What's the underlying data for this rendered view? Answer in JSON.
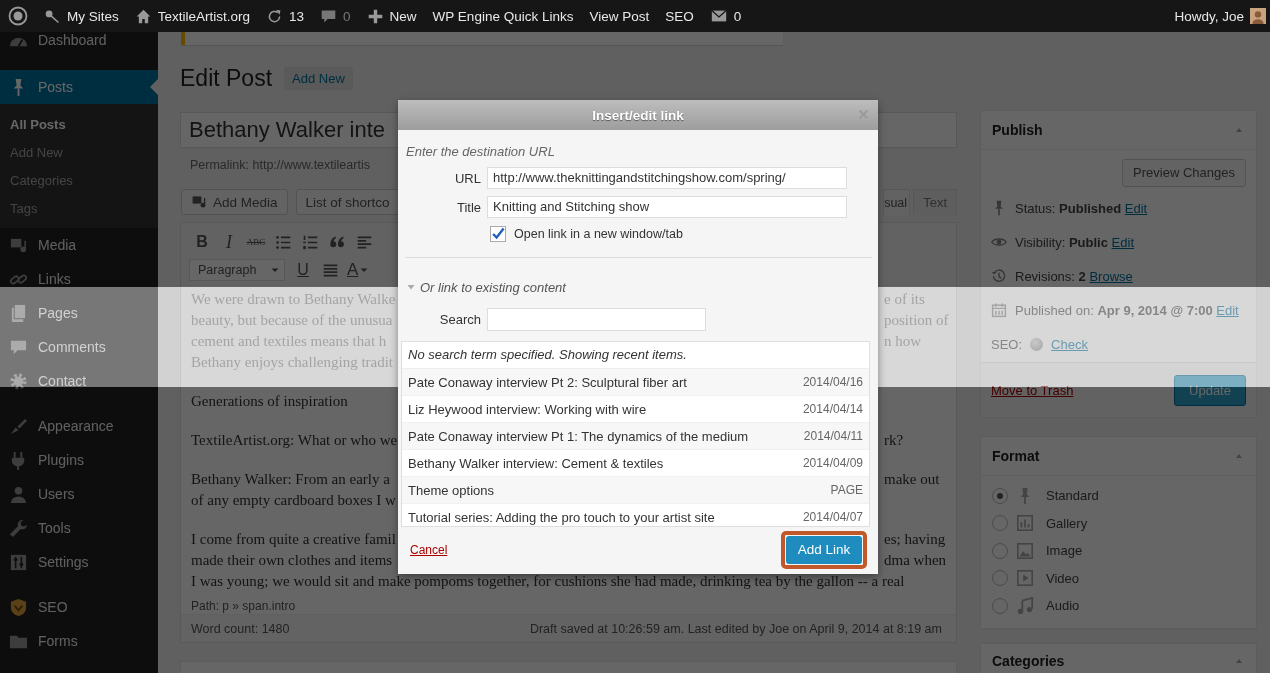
{
  "admin_bar": {
    "items": [
      {
        "kind": "logo"
      },
      {
        "kind": "sites",
        "label": "My Sites"
      },
      {
        "kind": "home",
        "label": "TextileArtist.org"
      },
      {
        "kind": "updates",
        "label": "13"
      },
      {
        "kind": "comments",
        "label": "0"
      },
      {
        "kind": "new",
        "label": "New"
      },
      {
        "kind": "plain",
        "label": "WP Engine Quick Links"
      },
      {
        "kind": "plain",
        "label": "View Post"
      },
      {
        "kind": "plain",
        "label": "SEO"
      },
      {
        "kind": "mail",
        "label": "0"
      }
    ],
    "greeting": "Howdy, Joe"
  },
  "sidebar": {
    "groups": [
      [
        {
          "label": "Dashboard",
          "kind": "dashboard",
          "selected": false
        },
        {
          "label": "Posts",
          "kind": "pin",
          "selected": true,
          "children": [
            {
              "label": "All Posts",
              "selected": true
            },
            {
              "label": "Add New",
              "selected": false
            },
            {
              "label": "Categories",
              "selected": false
            },
            {
              "label": "Tags",
              "selected": false
            }
          ]
        },
        {
          "label": "Media",
          "kind": "media",
          "selected": false
        },
        {
          "label": "Links",
          "kind": "link",
          "selected": false
        },
        {
          "label": "Pages",
          "kind": "pages",
          "selected": false
        },
        {
          "label": "Comments",
          "kind": "comment",
          "selected": false
        },
        {
          "label": "Contact",
          "kind": "gear",
          "selected": false
        }
      ],
      [
        {
          "label": "Appearance",
          "kind": "brush",
          "selected": false
        },
        {
          "label": "Plugins",
          "kind": "plug",
          "selected": false
        },
        {
          "label": "Users",
          "kind": "user",
          "selected": false
        },
        {
          "label": "Tools",
          "kind": "wrench",
          "selected": false
        },
        {
          "label": "Settings",
          "kind": "settings",
          "selected": false
        }
      ],
      [
        {
          "label": "SEO",
          "kind": "seo",
          "selected": false
        },
        {
          "label": "Forms",
          "kind": "folder",
          "selected": false
        }
      ]
    ]
  },
  "header": {
    "title": "Edit Post",
    "action": "Add New"
  },
  "post": {
    "title": "Bethany Walker inte",
    "permalink": "Permalink: http://www.textileartis",
    "buttons": [
      {
        "kind": "media",
        "label": "Add Media"
      },
      {
        "kind": "select",
        "label": "List of shortco"
      }
    ],
    "tabs": [
      {
        "label": "sual",
        "selected": true
      },
      {
        "label": "Text",
        "selected": false
      }
    ],
    "toolbar": [
      [
        {
          "kind": "bold",
          "label": "B"
        },
        {
          "kind": "italic",
          "label": "I"
        },
        {
          "kind": "strike",
          "label": "ABC"
        },
        {
          "kind": "ul"
        },
        {
          "kind": "ol"
        },
        {
          "kind": "quote"
        },
        {
          "kind": "align-left"
        }
      ],
      [
        {
          "kind": "select",
          "label": "Paragraph"
        },
        {
          "kind": "underline",
          "label": "U"
        },
        {
          "kind": "justify"
        },
        {
          "kind": "color",
          "label": "A"
        }
      ]
    ],
    "content": [
      {
        "kind": "intro",
        "lines": [
          {
            "left": "We were drawn to Bethany Walke",
            "right": "e of its"
          },
          {
            "left": "beauty, but because of the unusua",
            "right": "position of"
          },
          {
            "left": "cement and textiles means that h",
            "right": "n how"
          },
          {
            "left": "Bethany enjoys challenging tradit"
          }
        ]
      },
      {
        "kind": "heading",
        "lines": [
          {
            "left": "Generations of inspiration"
          }
        ]
      },
      {
        "kind": "para",
        "lines": [
          {
            "left": "TextileArtist.org: What or who we",
            "right": "rk?"
          }
        ]
      },
      {
        "kind": "para",
        "lines": [
          {
            "left": "Bethany Walker: From an early a",
            "right": "make out"
          },
          {
            "left": "of any empty cardboard boxes I w"
          }
        ]
      },
      {
        "kind": "para",
        "lines": [
          {
            "left": "I come from quite a creative famil",
            "right": "es; having"
          },
          {
            "left": "made their own clothes and items",
            "right": "dma when"
          },
          {
            "left": "I was young; we would sit and make pompoms together, for cushions she had made, drinking tea by the gallon -- a real"
          }
        ]
      }
    ],
    "path": "Path: p » span.intro",
    "word_count": "Word count: 1480",
    "draft_status": "Draft saved at 10:26:59 am. Last edited by Joe on April 9, 2014 at 8:19 am"
  },
  "publish": {
    "title": "Publish",
    "preview": "Preview Changes",
    "rows": [
      {
        "kind": "pin",
        "label": "Status:",
        "value": "Published",
        "link": "Edit"
      },
      {
        "kind": "eye",
        "label": "Visibility:",
        "value": "Public",
        "link": "Edit"
      },
      {
        "kind": "clock",
        "label": "Revisions:",
        "value": "2",
        "link": "Browse"
      },
      {
        "kind": "calendar",
        "label": "Published on:",
        "value": "Apr 9, 2014 @ 7:00",
        "link": "Edit"
      }
    ],
    "seo": {
      "label": "SEO:",
      "link": "Check"
    },
    "trash": "Move to Trash",
    "update": "Update"
  },
  "format": {
    "title": "Format",
    "options": [
      {
        "label": "Standard",
        "kind": "pin",
        "selected": true
      },
      {
        "label": "Gallery",
        "kind": "gallery",
        "selected": false
      },
      {
        "label": "Image",
        "kind": "image",
        "selected": false
      },
      {
        "label": "Video",
        "kind": "video",
        "selected": false
      },
      {
        "label": "Audio",
        "kind": "audio",
        "selected": false
      }
    ]
  },
  "categories": {
    "title": "Categories"
  },
  "dialog": {
    "title": "Insert/edit link",
    "intro": "Enter the destination URL",
    "fields": [
      {
        "label": "URL",
        "value": "http://www.theknittingandstitchingshow.com/spring/"
      },
      {
        "label": "Title",
        "value": "Knitting and Stitching show"
      }
    ],
    "new_tab": {
      "label": "Open link in a new window/tab",
      "checked": true
    },
    "existing": {
      "label": "Or link to existing content",
      "expanded": true,
      "search_label": "Search",
      "notice": "No search term specified. Showing recent items.",
      "results": [
        {
          "title": "Pate Conaway interview Pt 2: Sculptural fiber art",
          "info": "2014/04/16",
          "selected": false
        },
        {
          "title": "Liz Heywood interview: Working with wire",
          "info": "2014/04/14",
          "selected": false
        },
        {
          "title": "Pate Conaway interview Pt 1: The dynamics of the medium",
          "info": "2014/04/11",
          "selected": false
        },
        {
          "title": "Bethany Walker interview: Cement & textiles",
          "info": "2014/04/09",
          "selected": false
        },
        {
          "title": "Theme options",
          "info": "PAGE",
          "selected": false
        },
        {
          "title": "Tutorial series: Adding the pro touch to your artist site",
          "info": "2014/04/07",
          "selected": false
        }
      ]
    },
    "cancel": "Cancel",
    "submit": {
      "label": "Add Link",
      "highlighted": true
    }
  }
}
